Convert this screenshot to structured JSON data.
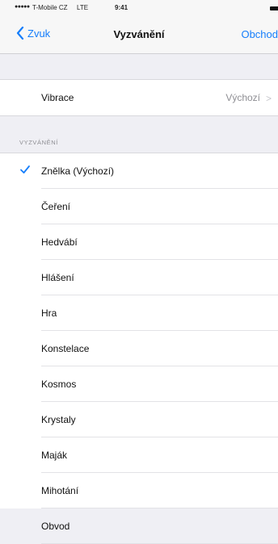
{
  "status_bar": {
    "signal": "●●●●●",
    "carrier": "T-Mobile CZ",
    "network": "LTE",
    "time": "9:41"
  },
  "nav": {
    "back_label": "Zvuk",
    "title": "Vyzvánění",
    "action_label": "Obchod"
  },
  "vibration_row": {
    "label": "Vibrace",
    "value": "Výchozí",
    "chevron": ">"
  },
  "ringtones": {
    "header": "VYZVÁNĚNÍ",
    "items": [
      {
        "label": "Znělka (Výchozí)",
        "selected": true
      },
      {
        "label": "Čeření",
        "selected": false
      },
      {
        "label": "Hedvábí",
        "selected": false
      },
      {
        "label": "Hlášení",
        "selected": false
      },
      {
        "label": "Hra",
        "selected": false
      },
      {
        "label": "Konstelace",
        "selected": false
      },
      {
        "label": "Kosmos",
        "selected": false
      },
      {
        "label": "Krystaly",
        "selected": false
      },
      {
        "label": "Maják",
        "selected": false
      },
      {
        "label": "Mihotání",
        "selected": false
      },
      {
        "label": "Obvod",
        "selected": false
      }
    ]
  },
  "colors": {
    "accent": "#157efb",
    "background": "#efeff4",
    "secondary_text": "#8e8e93"
  },
  "icons": {
    "back": "chevron-left-icon",
    "disclosure": "chevron-right-icon",
    "selected": "checkmark-icon"
  }
}
